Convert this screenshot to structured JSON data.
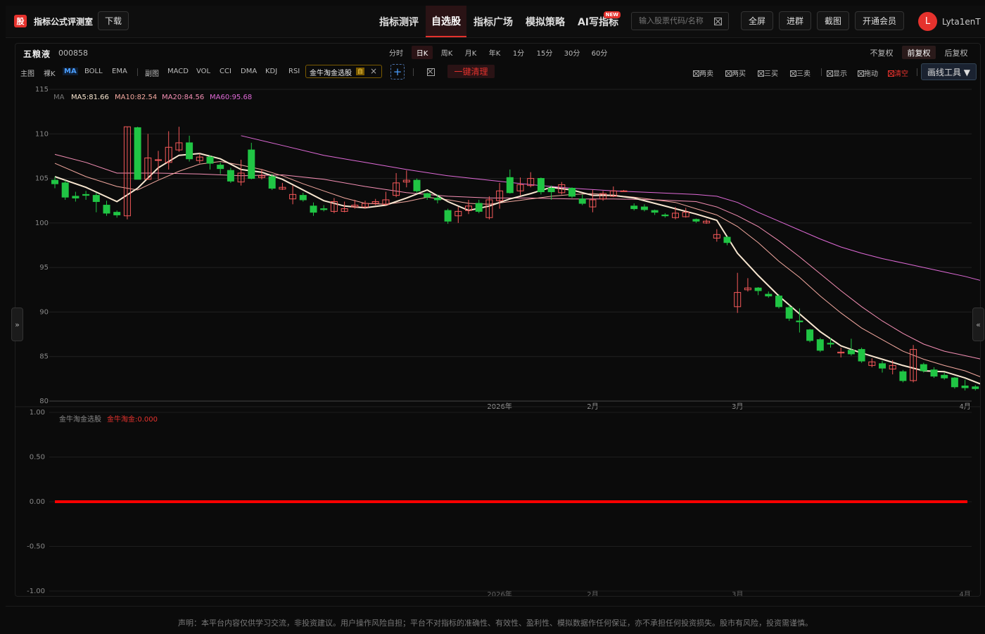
{
  "app": {
    "logo": "股",
    "name": "指标公式评测室",
    "download": "下载"
  },
  "nav": [
    {
      "label": "指标测评",
      "active": false
    },
    {
      "label": "自选股",
      "active": true
    },
    {
      "label": "指标广场",
      "active": false
    },
    {
      "label": "模拟策略",
      "active": false
    },
    {
      "label": "AI写指标",
      "active": false,
      "badge": "NEW"
    }
  ],
  "search": {
    "placeholder": "输入股票代码/名称"
  },
  "toolbar": {
    "fullscreen": "全屏",
    "join_group": "进群",
    "screenshot": "截图",
    "vip": "开通会员"
  },
  "user": {
    "initial": "L",
    "name": "Lyta1enT"
  },
  "stock": {
    "name": "五粮液",
    "code": "000858"
  },
  "periods": [
    {
      "label": "分时",
      "active": false
    },
    {
      "label": "日K",
      "active": true
    },
    {
      "label": "周K",
      "active": false
    },
    {
      "label": "月K",
      "active": false
    },
    {
      "label": "年K",
      "active": false
    },
    {
      "label": "1分",
      "active": false
    },
    {
      "label": "15分",
      "active": false
    },
    {
      "label": "30分",
      "active": false
    },
    {
      "label": "60分",
      "active": false
    }
  ],
  "adjust": [
    {
      "label": "不复权",
      "active": false
    },
    {
      "label": "前复权",
      "active": true
    },
    {
      "label": "后复权",
      "active": false
    }
  ],
  "main_indicators": {
    "label": "主图",
    "items": [
      {
        "label": "裸K",
        "active": false
      },
      {
        "label": "MA",
        "active": true
      },
      {
        "label": "BOLL",
        "active": false
      },
      {
        "label": "EMA",
        "active": false
      }
    ]
  },
  "sub_indicators": {
    "label": "副图",
    "items": [
      "MACD",
      "VOL",
      "CCI",
      "DMA",
      "KDJ",
      "RSI"
    ]
  },
  "custom_indicator": {
    "label": "金牛淘金选股",
    "tag": "自",
    "close": "×"
  },
  "add_button": "+",
  "clear_all": "一键清理",
  "signal_filters": [
    {
      "label": "两卖",
      "red": false
    },
    {
      "label": "两买",
      "red": false
    },
    {
      "label": "三买",
      "red": false
    },
    {
      "label": "三卖",
      "red": false
    },
    {
      "label": "显示",
      "red": false
    },
    {
      "label": "拖动",
      "red": false
    },
    {
      "label": "清空",
      "red": true
    }
  ],
  "draw_tool": "画线工具 ▼",
  "side_toggles": {
    "left": "»",
    "right": "«"
  },
  "colors": {
    "up": "#f5595a",
    "down": "#20c544",
    "ma5": "#f8e6d0",
    "ma10": "#f4a9a0",
    "ma20": "#f58fb5",
    "ma60": "#e06ad8",
    "accent": "#e5322d",
    "signal_line": "#ff0000"
  },
  "chart_data": [
    {
      "type": "candlestick",
      "title": "五粮液 000858 日K 前复权",
      "ylim": [
        80,
        115
      ],
      "y_ticks": [
        115,
        110,
        105,
        100,
        95,
        90,
        85,
        80
      ],
      "x_labels": [
        "2026年",
        "2月",
        "3月",
        "4月"
      ],
      "x_label_index": [
        43,
        52,
        66,
        88
      ],
      "legend": {
        "name": "MA",
        "items": [
          "MA5:81.66",
          "MA10:82.54",
          "MA20:84.56",
          "MA60:95.68"
        ]
      },
      "candles": [
        [
          104.8,
          104.4,
          105.2,
          103.9
        ],
        [
          104.5,
          102.9,
          104.8,
          102.6
        ],
        [
          103.0,
          102.8,
          103.5,
          102.4
        ],
        [
          103.2,
          103.1,
          103.6,
          102.6
        ],
        [
          103.1,
          102.4,
          103.4,
          101.2
        ],
        [
          102.0,
          101.1,
          102.5,
          100.8
        ],
        [
          101.2,
          100.9,
          101.4,
          100.6
        ],
        [
          100.8,
          110.8,
          110.8,
          100.4
        ],
        [
          110.7,
          104.9,
          110.8,
          104.9
        ],
        [
          104.9,
          107.3,
          110.0,
          104.9
        ],
        [
          107.1,
          107.1,
          108.1,
          104.9
        ],
        [
          106.8,
          108.5,
          110.3,
          106.0
        ],
        [
          108.2,
          109.0,
          110.8,
          108.0
        ],
        [
          109.0,
          107.2,
          109.8,
          106.9
        ],
        [
          107.0,
          107.4,
          107.8,
          106.7
        ],
        [
          107.4,
          106.7,
          107.6,
          106.0
        ],
        [
          106.5,
          106.1,
          106.8,
          105.5
        ],
        [
          105.9,
          104.7,
          106.2,
          104.5
        ],
        [
          104.6,
          105.6,
          107.1,
          104.2
        ],
        [
          108.2,
          105.0,
          109.0,
          104.9
        ],
        [
          105.1,
          105.3,
          106.0,
          104.9
        ],
        [
          105.2,
          103.9,
          105.5,
          103.7
        ],
        [
          103.8,
          104.0,
          104.5,
          103.7
        ],
        [
          102.7,
          103.2,
          104.2,
          102.1
        ],
        [
          103.1,
          102.6,
          103.4,
          102.4
        ],
        [
          101.9,
          101.2,
          102.3,
          100.8
        ],
        [
          101.6,
          101.5,
          102.0,
          101.3
        ],
        [
          101.3,
          102.4,
          102.8,
          101.1
        ],
        [
          101.3,
          101.6,
          102.4,
          101.2
        ],
        [
          101.8,
          102.0,
          102.6,
          101.6
        ],
        [
          101.8,
          102.2,
          102.5,
          101.6
        ],
        [
          102.2,
          102.4,
          102.7,
          102.0
        ],
        [
          102.1,
          102.6,
          103.5,
          102.0
        ],
        [
          103.1,
          104.5,
          105.6,
          102.9
        ],
        [
          104.6,
          104.8,
          105.9,
          104.0
        ],
        [
          104.8,
          103.6,
          105.0,
          103.4
        ],
        [
          103.3,
          102.9,
          103.4,
          102.6
        ],
        [
          102.8,
          102.6,
          103.2,
          102.2
        ],
        [
          101.4,
          100.2,
          101.6,
          99.9
        ],
        [
          100.8,
          101.3,
          101.8,
          100.0
        ],
        [
          101.4,
          101.9,
          102.6,
          101.0
        ],
        [
          102.2,
          101.3,
          102.6,
          101.1
        ],
        [
          100.6,
          102.6,
          103.0,
          100.4
        ],
        [
          102.5,
          103.6,
          104.5,
          101.6
        ],
        [
          105.1,
          103.4,
          106.0,
          103.3
        ],
        [
          103.6,
          104.3,
          105.1,
          103.1
        ],
        [
          104.2,
          105.0,
          105.7,
          104.0
        ],
        [
          105.0,
          103.5,
          105.1,
          103.2
        ],
        [
          103.9,
          103.5,
          104.2,
          102.6
        ],
        [
          103.4,
          104.3,
          104.6,
          103.2
        ],
        [
          103.9,
          103.0,
          104.0,
          102.8
        ],
        [
          102.7,
          102.2,
          103.2,
          102.0
        ],
        [
          101.8,
          102.6,
          103.7,
          101.2
        ],
        [
          102.7,
          103.3,
          103.6,
          102.5
        ],
        [
          103.0,
          103.6,
          104.1,
          102.9
        ],
        [
          103.6,
          103.6,
          103.7,
          103.5
        ],
        [
          101.9,
          101.6,
          102.2,
          101.4
        ],
        [
          101.8,
          101.5,
          102.1,
          101.3
        ],
        [
          101.4,
          101.2,
          101.5,
          100.9
        ],
        [
          100.9,
          100.8,
          101.1,
          100.6
        ],
        [
          100.6,
          101.1,
          101.8,
          100.4
        ],
        [
          100.7,
          101.2,
          101.7,
          100.6
        ],
        [
          100.4,
          100.2,
          100.5,
          100.0
        ],
        [
          100.0,
          100.2,
          100.4,
          99.9
        ],
        [
          98.3,
          98.7,
          99.3,
          97.9
        ],
        [
          98.4,
          97.8,
          98.5,
          97.5
        ],
        [
          90.6,
          92.2,
          94.4,
          89.9
        ],
        [
          92.5,
          92.7,
          93.8,
          92.3
        ],
        [
          92.7,
          92.4,
          92.8,
          91.9
        ],
        [
          92.0,
          91.8,
          92.3,
          91.6
        ],
        [
          91.8,
          90.6,
          92.0,
          90.4
        ],
        [
          90.5,
          89.3,
          90.8,
          89.0
        ],
        [
          89.0,
          88.9,
          90.4,
          87.7
        ],
        [
          88.0,
          86.8,
          88.1,
          86.6
        ],
        [
          86.9,
          85.7,
          87.1,
          85.5
        ],
        [
          86.5,
          86.4,
          87.1,
          86.0
        ],
        [
          85.4,
          85.5,
          86.0,
          84.9
        ],
        [
          85.7,
          85.3,
          87.0,
          85.1
        ],
        [
          85.8,
          84.5,
          86.0,
          84.3
        ],
        [
          84.0,
          84.4,
          84.8,
          83.8
        ],
        [
          84.2,
          83.7,
          84.5,
          83.2
        ],
        [
          83.6,
          84.0,
          84.6,
          83.0
        ],
        [
          83.3,
          82.3,
          83.5,
          82.1
        ],
        [
          82.3,
          85.8,
          86.3,
          82.1
        ],
        [
          84.1,
          83.4,
          84.3,
          83.2
        ],
        [
          83.5,
          82.8,
          83.8,
          82.6
        ],
        [
          82.9,
          82.6,
          83.2,
          82.4
        ],
        [
          82.6,
          81.6,
          82.7,
          81.4
        ],
        [
          81.7,
          81.5,
          82.4,
          81.2
        ],
        [
          81.6,
          81.4,
          81.8,
          81.2
        ]
      ],
      "ma5": [
        [
          0,
          105.2
        ],
        [
          3,
          104.0
        ],
        [
          6,
          102.4
        ],
        [
          8,
          103.9
        ],
        [
          10,
          106.2
        ],
        [
          12,
          107.6
        ],
        [
          14,
          107.8
        ],
        [
          16,
          107.2
        ],
        [
          18,
          106.0
        ],
        [
          20,
          105.7
        ],
        [
          22,
          104.9
        ],
        [
          24,
          103.7
        ],
        [
          26,
          102.5
        ],
        [
          28,
          101.9
        ],
        [
          30,
          101.7
        ],
        [
          32,
          102.0
        ],
        [
          34,
          102.8
        ],
        [
          36,
          103.7
        ],
        [
          38,
          102.4
        ],
        [
          40,
          101.4
        ],
        [
          42,
          101.9
        ],
        [
          44,
          102.7
        ],
        [
          46,
          103.3
        ],
        [
          48,
          104.0
        ],
        [
          50,
          103.7
        ],
        [
          52,
          103.1
        ],
        [
          54,
          103.1
        ],
        [
          56,
          102.8
        ],
        [
          58,
          102.2
        ],
        [
          60,
          101.6
        ],
        [
          62,
          101.0
        ],
        [
          64,
          100.3
        ],
        [
          66,
          96.6
        ],
        [
          68,
          94.1
        ],
        [
          70,
          91.8
        ],
        [
          72,
          89.8
        ],
        [
          74,
          87.8
        ],
        [
          76,
          86.2
        ],
        [
          78,
          85.4
        ],
        [
          80,
          84.7
        ],
        [
          82,
          84.0
        ],
        [
          84,
          83.4
        ],
        [
          86,
          83.3
        ],
        [
          88,
          82.6
        ],
        [
          90,
          81.7
        ]
      ],
      "ma10": [
        [
          0,
          106.7
        ],
        [
          3,
          105.2
        ],
        [
          6,
          104.1
        ],
        [
          8,
          103.7
        ],
        [
          10,
          104.8
        ],
        [
          12,
          105.8
        ],
        [
          14,
          106.6
        ],
        [
          16,
          106.9
        ],
        [
          18,
          106.5
        ],
        [
          20,
          106.0
        ],
        [
          22,
          105.3
        ],
        [
          24,
          104.4
        ],
        [
          26,
          103.6
        ],
        [
          28,
          102.8
        ],
        [
          30,
          102.2
        ],
        [
          32,
          102.1
        ],
        [
          34,
          102.4
        ],
        [
          36,
          102.9
        ],
        [
          38,
          102.6
        ],
        [
          40,
          102.2
        ],
        [
          42,
          102.1
        ],
        [
          44,
          102.4
        ],
        [
          46,
          102.7
        ],
        [
          48,
          103.0
        ],
        [
          50,
          103.2
        ],
        [
          52,
          103.3
        ],
        [
          54,
          103.1
        ],
        [
          56,
          102.9
        ],
        [
          58,
          102.6
        ],
        [
          60,
          102.3
        ],
        [
          62,
          101.6
        ],
        [
          64,
          100.9
        ],
        [
          66,
          99.6
        ],
        [
          68,
          97.8
        ],
        [
          70,
          95.7
        ],
        [
          72,
          93.9
        ],
        [
          74,
          91.8
        ],
        [
          76,
          89.9
        ],
        [
          78,
          88.2
        ],
        [
          80,
          86.9
        ],
        [
          82,
          85.6
        ],
        [
          84,
          84.7
        ],
        [
          86,
          84.0
        ],
        [
          88,
          83.4
        ],
        [
          90,
          82.5
        ]
      ],
      "ma20": [
        [
          0,
          107.7
        ],
        [
          3,
          106.8
        ],
        [
          6,
          105.6
        ],
        [
          8,
          105.6
        ],
        [
          10,
          105.6
        ],
        [
          14,
          105.5
        ],
        [
          18,
          105.3
        ],
        [
          22,
          105.4
        ],
        [
          26,
          104.9
        ],
        [
          30,
          104.1
        ],
        [
          34,
          103.4
        ],
        [
          38,
          103.0
        ],
        [
          42,
          102.8
        ],
        [
          46,
          102.8
        ],
        [
          50,
          102.7
        ],
        [
          54,
          102.7
        ],
        [
          58,
          102.6
        ],
        [
          62,
          102.4
        ],
        [
          64,
          101.8
        ],
        [
          66,
          100.8
        ],
        [
          68,
          99.6
        ],
        [
          70,
          98.0
        ],
        [
          72,
          96.2
        ],
        [
          74,
          94.3
        ],
        [
          76,
          92.4
        ],
        [
          78,
          90.6
        ],
        [
          80,
          89.0
        ],
        [
          82,
          87.6
        ],
        [
          84,
          86.4
        ],
        [
          86,
          85.6
        ],
        [
          88,
          85.1
        ],
        [
          90,
          84.6
        ]
      ],
      "ma60": [
        [
          18,
          109.8
        ],
        [
          22,
          108.7
        ],
        [
          26,
          107.6
        ],
        [
          30,
          106.8
        ],
        [
          34,
          106.0
        ],
        [
          38,
          105.3
        ],
        [
          42,
          104.8
        ],
        [
          46,
          104.3
        ],
        [
          50,
          103.9
        ],
        [
          54,
          103.6
        ],
        [
          58,
          103.4
        ],
        [
          62,
          103.2
        ],
        [
          64,
          103.0
        ],
        [
          66,
          102.3
        ],
        [
          68,
          101.2
        ],
        [
          70,
          100.2
        ],
        [
          72,
          99.2
        ],
        [
          74,
          98.2
        ],
        [
          76,
          97.3
        ],
        [
          78,
          96.6
        ],
        [
          80,
          96.0
        ],
        [
          82,
          95.5
        ],
        [
          84,
          95.0
        ],
        [
          86,
          94.5
        ],
        [
          88,
          94.0
        ],
        [
          90,
          93.4
        ]
      ]
    },
    {
      "type": "line",
      "title": "金牛淘金选股",
      "series": [
        {
          "name": "金牛淘金:0.000",
          "values": [
            0
          ]
        }
      ],
      "ylim": [
        -1.0,
        1.0
      ],
      "y_ticks": [
        "1.00",
        "0.50",
        "0.00",
        "-0.50",
        "-1.00"
      ],
      "x_labels": [
        "2026年",
        "2月",
        "3月",
        "4月"
      ]
    }
  ],
  "disclaimer": "声明：本平台内容仅供学习交流，非投资建议。用户操作风险自担；平台不对指标的准确性、有效性、盈利性、模拟数据作任何保证，亦不承担任何投资损失。股市有风险，投资需谨慎。"
}
